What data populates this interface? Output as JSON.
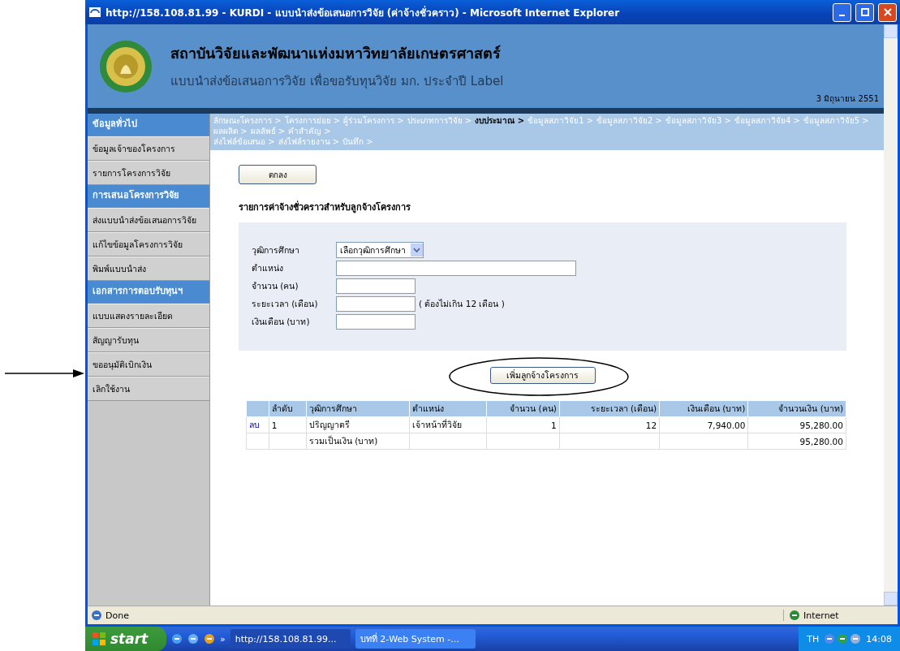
{
  "window": {
    "title": "http://158.108.81.99 - KURDI - แบบนำส่งข้อเสนอการวิจัย (ค่าจ้างชั่วคราว) - Microsoft Internet Explorer"
  },
  "header": {
    "title": "สถาบันวิจัยและพัฒนาแห่งมหาวิทยาลัยเกษตรศาสตร์",
    "subtitle": "แบบนำส่งข้อเสนอการวิจัย เพื่อขอรับทุนวิจัย มก. ประจำปี Label",
    "date": "3 มิถุนายน 2551"
  },
  "sidebar": {
    "items": [
      {
        "kind": "header",
        "label": "ข้อมูลทั่วไป"
      },
      {
        "kind": "item",
        "label": "ข้อมูลเจ้าของโครงการ"
      },
      {
        "kind": "item",
        "label": "รายการโครงการวิจัย"
      },
      {
        "kind": "header",
        "label": "การเสนอโครงการวิจัย"
      },
      {
        "kind": "item",
        "label": "ส่งแบบนำส่งข้อเสนอการวิจัย"
      },
      {
        "kind": "item",
        "label": "แก้ไขข้อมูลโครงการวิจัย"
      },
      {
        "kind": "item",
        "label": "พิมพ์แบบนำส่ง"
      },
      {
        "kind": "header",
        "label": "เอกสารการตอบรับทุนฯ"
      },
      {
        "kind": "item",
        "label": "แบบแสดงรายละเอียด"
      },
      {
        "kind": "item",
        "label": "สัญญารับทุน"
      },
      {
        "kind": "item",
        "label": "ขออนุมัติเบิกเงิน"
      },
      {
        "kind": "item",
        "label": "เลิกใช้งาน"
      }
    ]
  },
  "breadcrumb": {
    "lines": [
      [
        {
          "label": "ลักษณะโครงการ >",
          "selected": false
        },
        {
          "label": "โครงการย่อย >",
          "selected": false
        },
        {
          "label": "ผู้ร่วมโครงการ >",
          "selected": false
        },
        {
          "label": "ประเภทการวิจัย >",
          "selected": false
        },
        {
          "label": "งบประมาณ >",
          "selected": true
        },
        {
          "label": "ข้อมูลสภาวิจัย1 >",
          "selected": false
        },
        {
          "label": "ข้อมูลสภาวิจัย2 >",
          "selected": false
        },
        {
          "label": "ข้อมูลสภาวิจัย3 >",
          "selected": false
        },
        {
          "label": "ข้อมูลสภาวิจัย4 >",
          "selected": false
        },
        {
          "label": "ข้อมูลสภาวิจัย5 >",
          "selected": false
        },
        {
          "label": "ผลผลิต >",
          "selected": false
        },
        {
          "label": "ผลลัพธ์ >",
          "selected": false
        },
        {
          "label": "คำสำคัญ >",
          "selected": false
        }
      ],
      [
        {
          "label": "ส่งไฟล์ข้อเสนอ >",
          "selected": false
        },
        {
          "label": "ส่งไฟล์รายงาน >",
          "selected": false
        },
        {
          "label": "บันทึก >",
          "selected": false
        }
      ]
    ]
  },
  "ok_button": "ตกลง",
  "section_title": "รายการค่าจ้างชั่วคราวสำหรับลูกจ้างโครงการ",
  "form": {
    "fields": [
      {
        "kind": "select",
        "label": "วุฒิการศึกษา",
        "value": "เลือกวุฒิการศึกษา"
      },
      {
        "kind": "wide",
        "label": "ตำแหน่ง"
      },
      {
        "kind": "short",
        "label": "จำนวน (คน)"
      },
      {
        "kind": "short",
        "label": "ระยะเวลา (เดือน)",
        "note": "( ต้องไม่เกิน 12 เดือน )"
      },
      {
        "kind": "short",
        "label": "เงินเดือน (บาท)"
      }
    ]
  },
  "add_button": "เพิ่มลูกจ้างโครงการ",
  "table": {
    "columns": [
      "ลำดับ",
      "วุฒิการศึกษา",
      "ตำแหน่ง",
      "จำนวน (คน)",
      "ระยะเวลา (เดือน)",
      "เงินเดือน (บาท)",
      "จำนวนเงิน (บาท)"
    ],
    "rows": [
      {
        "delete_link": "ลบ",
        "cells": [
          "1",
          "ปริญญาตรี",
          "เจ้าหน้าที่วิจัย",
          "1",
          "12",
          "7,940.00",
          "95,280.00"
        ]
      }
    ],
    "total": {
      "label": "รวมเป็นเงิน (บาท)",
      "amount": "95,280.00"
    }
  },
  "status_bar": {
    "status": "Done",
    "zone": "Internet"
  },
  "taskbar": {
    "start": "start",
    "more": "»",
    "tasks": [
      {
        "label": "http://158.108.81.99...",
        "selected": true
      },
      {
        "label": "บทที่ 2-Web System -...",
        "selected": false
      }
    ],
    "language": "TH",
    "clock": "14:08"
  }
}
